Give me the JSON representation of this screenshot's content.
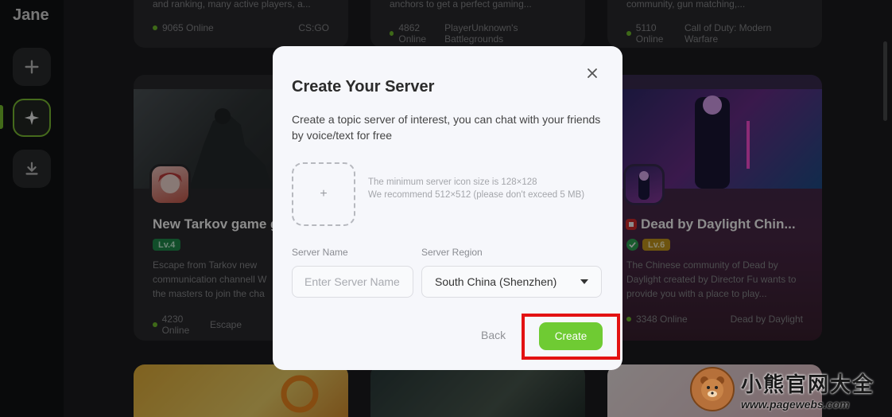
{
  "sidebar": {
    "brand": "Jane"
  },
  "top_cards": [
    {
      "desc": "and ranking, many active players, a...",
      "online": "9065 Online",
      "game": "CS:GO"
    },
    {
      "desc": "anchors to get a perfect gaming...",
      "online": "4862 Online",
      "game": "PlayerUnknown's Battlegrounds"
    },
    {
      "desc": "community, gun matching,...",
      "online": "5110 Online",
      "game": "Call of Duty: Modern Warfare"
    }
  ],
  "middle_cards": [
    {
      "title": "New Tarkov game g",
      "level": "Lv.4",
      "desc": "Escape from Tarkov new communication channell W the masters to join the cha",
      "online": "4230 Online",
      "game": "Escape"
    },
    {
      "title": "Dead by Daylight Chin...",
      "level": "Lv.6",
      "desc": "The Chinese community of Dead by Daylight created by Director Fu wants to provide you with a place to play...",
      "online": "3348 Online",
      "game": "Dead by Daylight"
    }
  ],
  "modal": {
    "title": "Create Your Server",
    "description": "Create a topic server of interest, you can chat with your friends by voice/text for free",
    "upload_plus": "+",
    "upload_hint_1": "The minimum server icon size is 128×128",
    "upload_hint_2": "We recommend 512×512 (please don't exceed 5 MB)",
    "server_name_label": "Server Name",
    "server_name_placeholder": "Enter Server Name",
    "server_region_label": "Server Region",
    "server_region_value": "South China (Shenzhen)",
    "back_label": "Back",
    "create_label": "Create"
  },
  "watermark": {
    "title": "小熊官网大全",
    "url": "www.pagewebs.com"
  },
  "colors": {
    "accent": "#6fcb33",
    "highlight": "#e31212",
    "level_green": "#1f8f4e",
    "level_gold": "#c99a1c"
  }
}
